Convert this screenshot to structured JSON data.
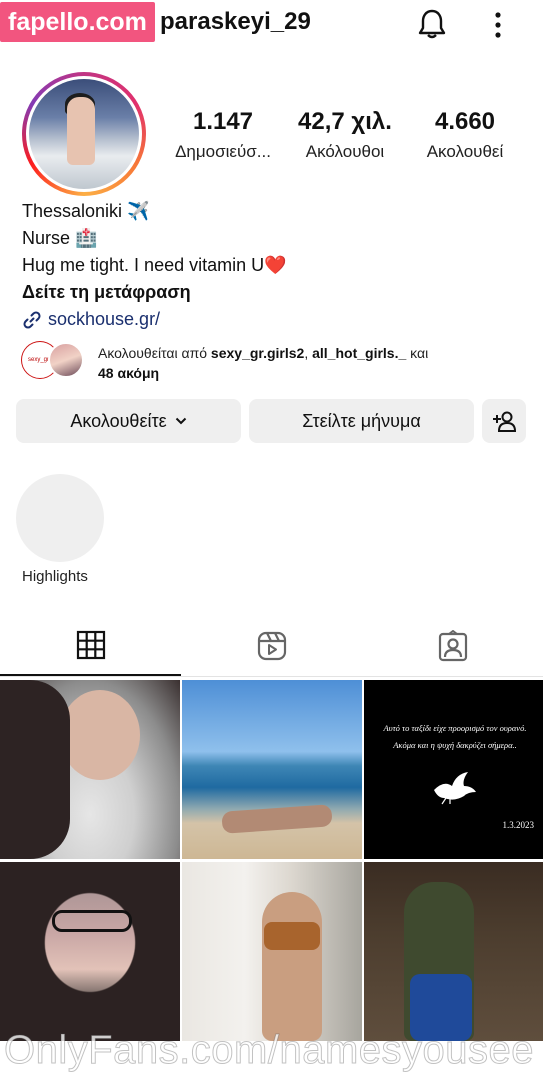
{
  "watermark": {
    "top": "fapello.com",
    "bottom": "OnlyFans.com/namesyousee"
  },
  "header": {
    "username": "paraskeyi_29",
    "icons": [
      "bell-icon",
      "more-icon"
    ]
  },
  "profile": {
    "stats": [
      {
        "value": "1.147",
        "label": "Δημοσιεύσ..."
      },
      {
        "value": "42,7 χιλ.",
        "label": "Ακόλουθοι"
      },
      {
        "value": "4.660",
        "label": "Ακολουθεί"
      }
    ],
    "bio": {
      "line1": "Thessaloniki ✈️",
      "line2": "Nurse 🏥",
      "line3": "Hug me tight. I need vitamin U❤️",
      "translate": "Δείτε τη μετάφραση",
      "link": "sockhouse.gr/"
    },
    "followed_by": {
      "prefix": "Ακολουθείται από ",
      "user1": "sexy_gr.girls2",
      "sep": ", ",
      "user2": "all_hot_girls._",
      "mid": " και",
      "more": "48 ακόμη"
    }
  },
  "actions": {
    "follow_label": "Ακολουθείτε",
    "message_label": "Στείλτε μήνυμα"
  },
  "highlights": {
    "label": "Highlights"
  },
  "tabs": [
    "grid-icon",
    "reels-icon",
    "tagged-icon"
  ],
  "posts": {
    "memorial": {
      "line1": "Αυτό το ταξίδι είχε προορισμό τον ουρανό.",
      "line2": "Ακόμα και η ψυχή δακρύζει σήμερα..",
      "date": "1.3.2023"
    }
  }
}
